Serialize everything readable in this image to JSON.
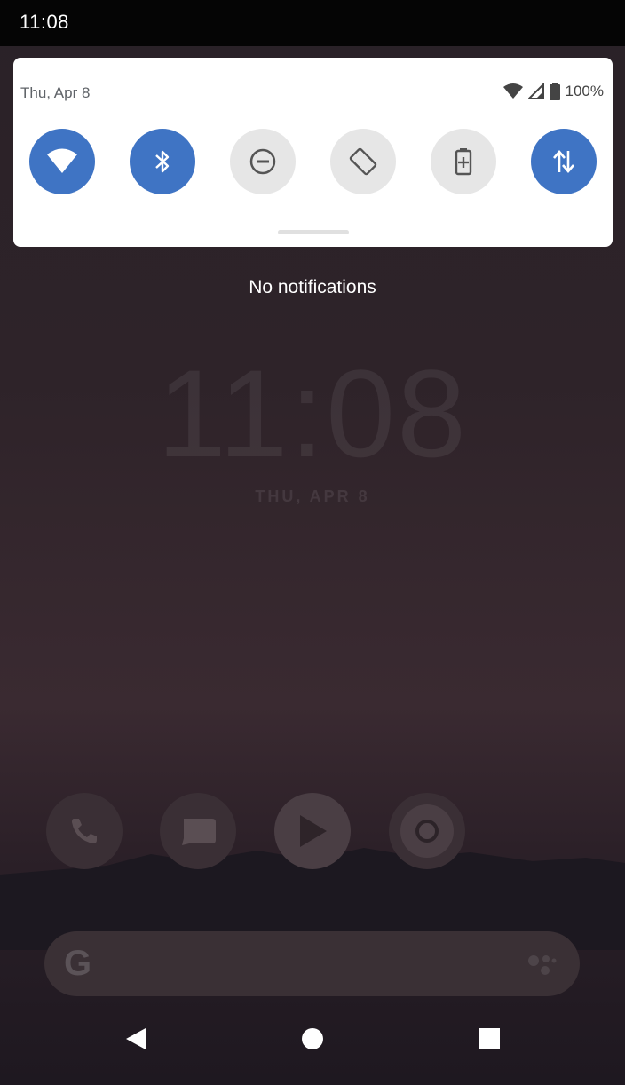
{
  "status_bar": {
    "time": "11:08"
  },
  "quick_settings": {
    "date": "Thu, Apr 8",
    "battery": "100%",
    "tiles": [
      {
        "name": "wifi",
        "icon": "wifi-icon",
        "active": true
      },
      {
        "name": "bluetooth",
        "icon": "bluetooth-icon",
        "active": true
      },
      {
        "name": "do-not-disturb",
        "icon": "do-not-disturb-icon",
        "active": false
      },
      {
        "name": "auto-rotate",
        "icon": "auto-rotate-icon",
        "active": false
      },
      {
        "name": "battery-saver",
        "icon": "battery-saver-icon",
        "active": false
      },
      {
        "name": "mobile-data",
        "icon": "mobile-data-icon",
        "active": true
      }
    ]
  },
  "notifications": {
    "empty_text": "No notifications"
  },
  "lock_screen": {
    "clock": "11:08",
    "date": "THU, APR 8"
  },
  "dock": {
    "apps": [
      "phone",
      "messages",
      "play-store",
      "chrome"
    ]
  },
  "search": {
    "logo": "G"
  },
  "colors": {
    "accent": "#3f74c4",
    "tile_off": "#e6e6e6"
  }
}
